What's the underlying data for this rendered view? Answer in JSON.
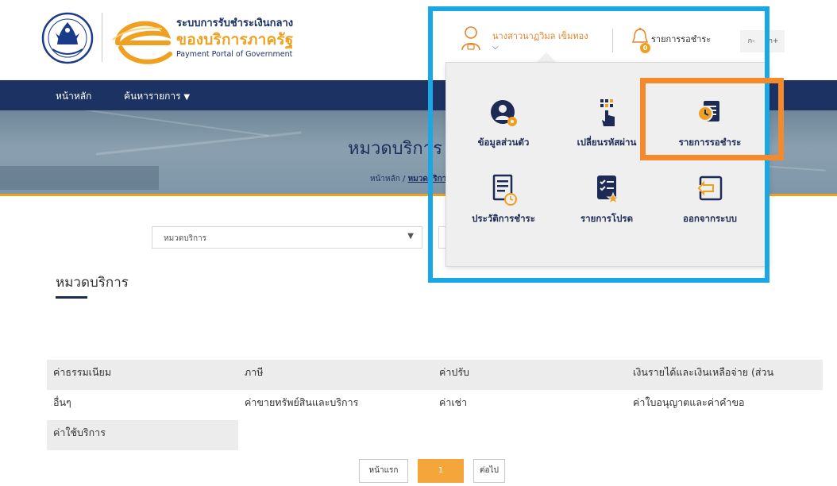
{
  "header": {
    "brand_th_line1": "ระบบการรับชำระเงินกลาง",
    "brand_th_line2": "ของบริการภาครัฐ",
    "brand_en": "Payment Portal of Government",
    "user_name": "นางสาวนาฏวิมล เข็มทอง",
    "notifications_label": "รายการรอชำระ",
    "notifications_count": "0",
    "font_decrease": "ก-",
    "font_increase": "ก+"
  },
  "nav": {
    "home": "หน้าหลัก",
    "search": "ค้นหารายการ"
  },
  "banner": {
    "title": "หมวดบริการ",
    "breadcrumb_home": "หน้าหลัก",
    "breadcrumb_sep": "/",
    "breadcrumb_current": "หมวดบริการ"
  },
  "filter": {
    "select_value": "หมวดบริการ"
  },
  "section": {
    "title": "หมวดบริการ"
  },
  "categories": [
    "ค่าธรรมเนียม",
    "ภาษี",
    "ค่าปรับ",
    "เงินรายได้และเงินเหลือจ่าย (ส่วน",
    "อื่นๆ",
    "ค่าขายทรัพย์สินและบริการ",
    "ค่าเช่า",
    "ค่าใบอนุญาตและค่าคำขอ",
    "ค่าใช้บริการ"
  ],
  "pagination": {
    "first": "หน้าแรก",
    "current": "1",
    "next": "ต่อไป"
  },
  "user_menu": {
    "items": [
      {
        "label": "ข้อมูลส่วนตัว",
        "icon": "profile-settings-icon"
      },
      {
        "label": "เปลี่ยนรหัสผ่าน",
        "icon": "keypad-icon"
      },
      {
        "label": "รายการรอชำระ",
        "icon": "pending-payment-icon"
      },
      {
        "label": "ประวัติการชำระ",
        "icon": "payment-history-icon"
      },
      {
        "label": "รายการโปรด",
        "icon": "favorites-icon"
      },
      {
        "label": "ออกจากระบบ",
        "icon": "logout-icon"
      }
    ]
  },
  "colors": {
    "navy": "#1c3263",
    "orange": "#f0a020",
    "highlight_blue": "#1aa7e6",
    "highlight_orange": "#f58a2c"
  }
}
